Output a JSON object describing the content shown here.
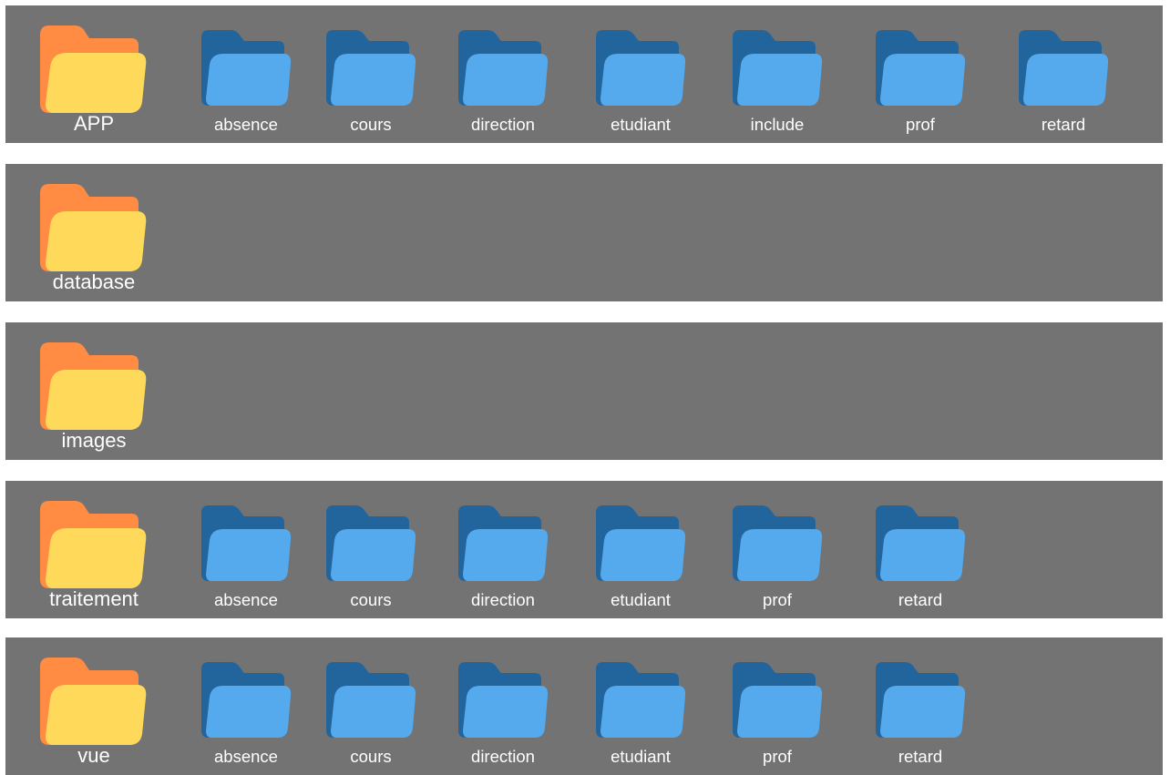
{
  "colors": {
    "row_background": "#737373",
    "parent_folder_back": "#FF8C42",
    "parent_folder_front": "#FFD95A",
    "child_folder_back": "#22649C",
    "child_folder_front": "#55AAEE",
    "label_text": "#FFFFFF"
  },
  "icons": {
    "parent": "folder-icon-orange-yellow",
    "child": "folder-icon-blue"
  },
  "rows": [
    {
      "parent": "APP",
      "children": [
        "absence",
        "cours",
        "direction",
        "etudiant",
        "include",
        "prof",
        "retard"
      ]
    },
    {
      "parent": "database",
      "children": []
    },
    {
      "parent": "images",
      "children": []
    },
    {
      "parent": "traitement",
      "children": [
        "absence",
        "cours",
        "direction",
        "etudiant",
        "prof",
        "retard"
      ]
    },
    {
      "parent": "vue",
      "children": [
        "absence",
        "cours",
        "direction",
        "etudiant",
        "prof",
        "retard"
      ]
    }
  ]
}
